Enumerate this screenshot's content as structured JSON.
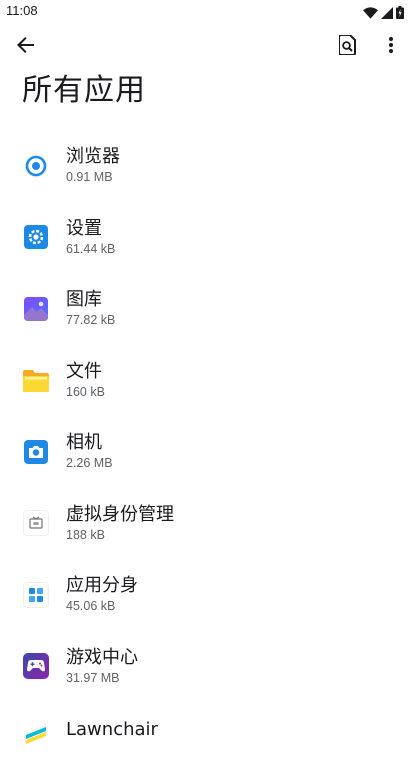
{
  "status_bar": {
    "time": "11:08"
  },
  "title": "所有应用",
  "apps": [
    {
      "name": "浏览器",
      "size": "0.91 MB",
      "icon": "browser-icon"
    },
    {
      "name": "设置",
      "size": "61.44 kB",
      "icon": "settings-icon"
    },
    {
      "name": "图库",
      "size": "77.82 kB",
      "icon": "gallery-icon"
    },
    {
      "name": "文件",
      "size": "160 kB",
      "icon": "files-icon"
    },
    {
      "name": "相机",
      "size": "2.26 MB",
      "icon": "camera-icon"
    },
    {
      "name": "虚拟身份管理",
      "size": "188 kB",
      "icon": "virtual-identity-icon"
    },
    {
      "name": "应用分身",
      "size": "45.06 kB",
      "icon": "app-clone-icon"
    },
    {
      "name": "游戏中心",
      "size": "31.97 MB",
      "icon": "game-center-icon"
    },
    {
      "name": "Lawnchair",
      "size": "",
      "icon": "lawnchair-icon"
    }
  ],
  "colors": {
    "text_primary": "#1b1b1f",
    "text_secondary": "#5f6368",
    "background": "#ffffff"
  }
}
